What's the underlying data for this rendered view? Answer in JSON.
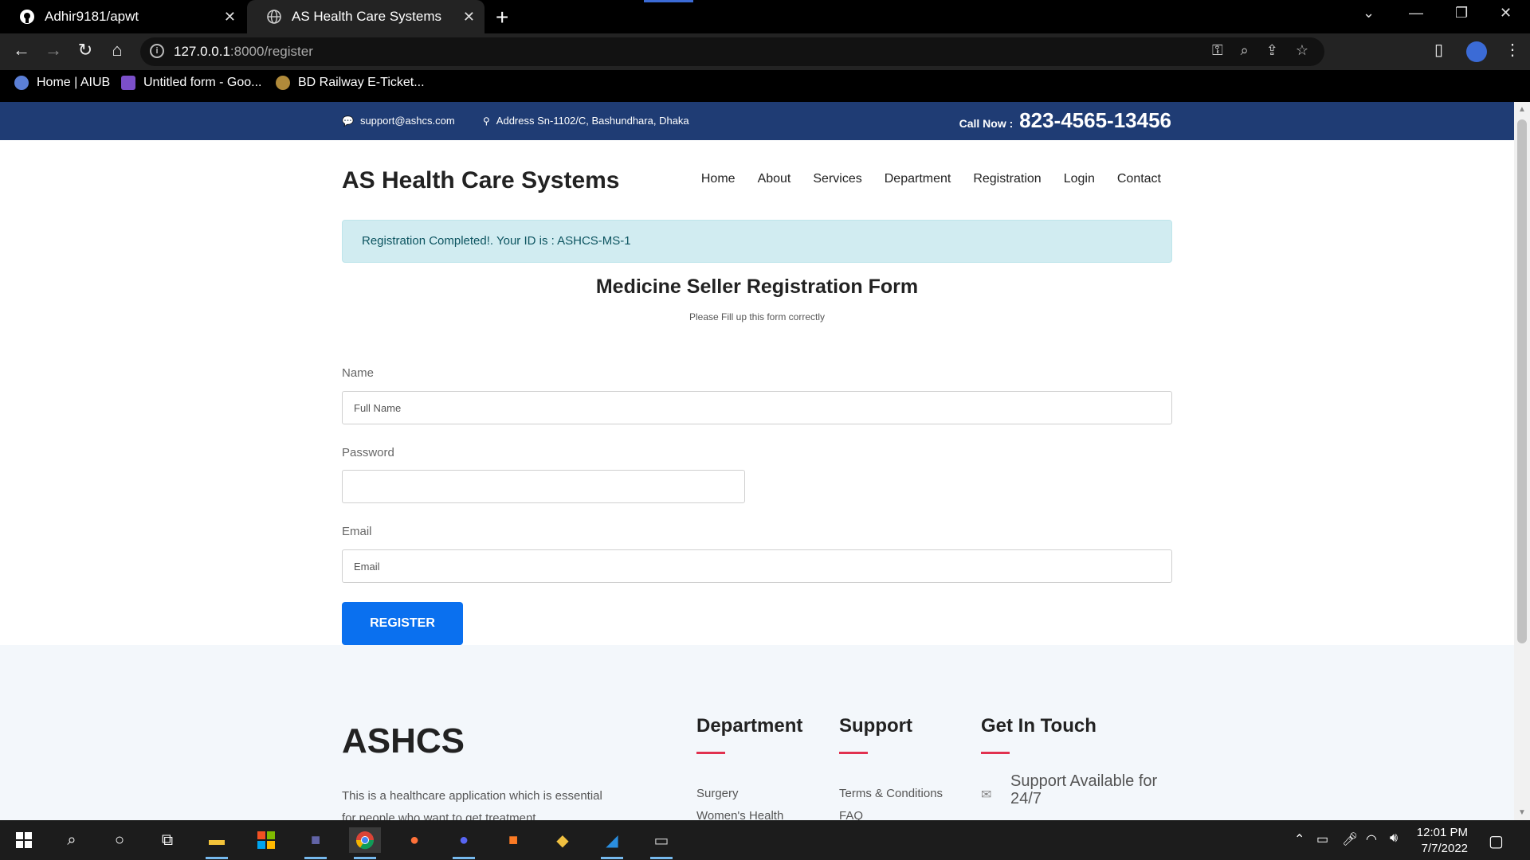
{
  "browser": {
    "tabs": [
      {
        "title": "Adhir9181/apwt",
        "icon": "github-icon"
      },
      {
        "title": "AS Health Care Systems",
        "icon": "globe-icon"
      }
    ],
    "url_host": "127.0.0.1",
    "url_path": ":8000/register",
    "bookmarks": [
      {
        "label": "Home | AIUB"
      },
      {
        "label": "Untitled form - Goo..."
      },
      {
        "label": "BD Railway E-Ticket..."
      }
    ]
  },
  "site": {
    "topbar": {
      "email": "support@ashcs.com",
      "address": "Address Sn-1102/C, Bashundhara, Dhaka",
      "call_label": "Call Now :",
      "phone": "823-4565-13456"
    },
    "brand": "AS Health Care Systems",
    "nav": [
      "Home",
      "About",
      "Services",
      "Department",
      "Registration",
      "Login",
      "Contact"
    ],
    "alert": "Registration Completed!. Your ID is : ASHCS-MS-1",
    "form": {
      "title": "Medicine Seller Registration Form",
      "subtitle": "Please Fill up this form correctly",
      "name_label": "Name",
      "name_placeholder": "Full Name",
      "password_label": "Password",
      "email_label": "Email",
      "email_placeholder": "Email",
      "submit": "REGISTER"
    },
    "footer": {
      "brand": "ASHCS",
      "description": "This is a healthcare application which is essential for people who want to get treatment",
      "department_title": "Department",
      "department_links": [
        "Surgery",
        "Women's Health"
      ],
      "support_title": "Support",
      "support_links": [
        "Terms & Conditions",
        "FAQ"
      ],
      "touch_title": "Get In Touch",
      "touch_text": "Support Available for 24/7"
    }
  },
  "taskbar": {
    "time": "12:01 PM",
    "date": "7/7/2022"
  }
}
